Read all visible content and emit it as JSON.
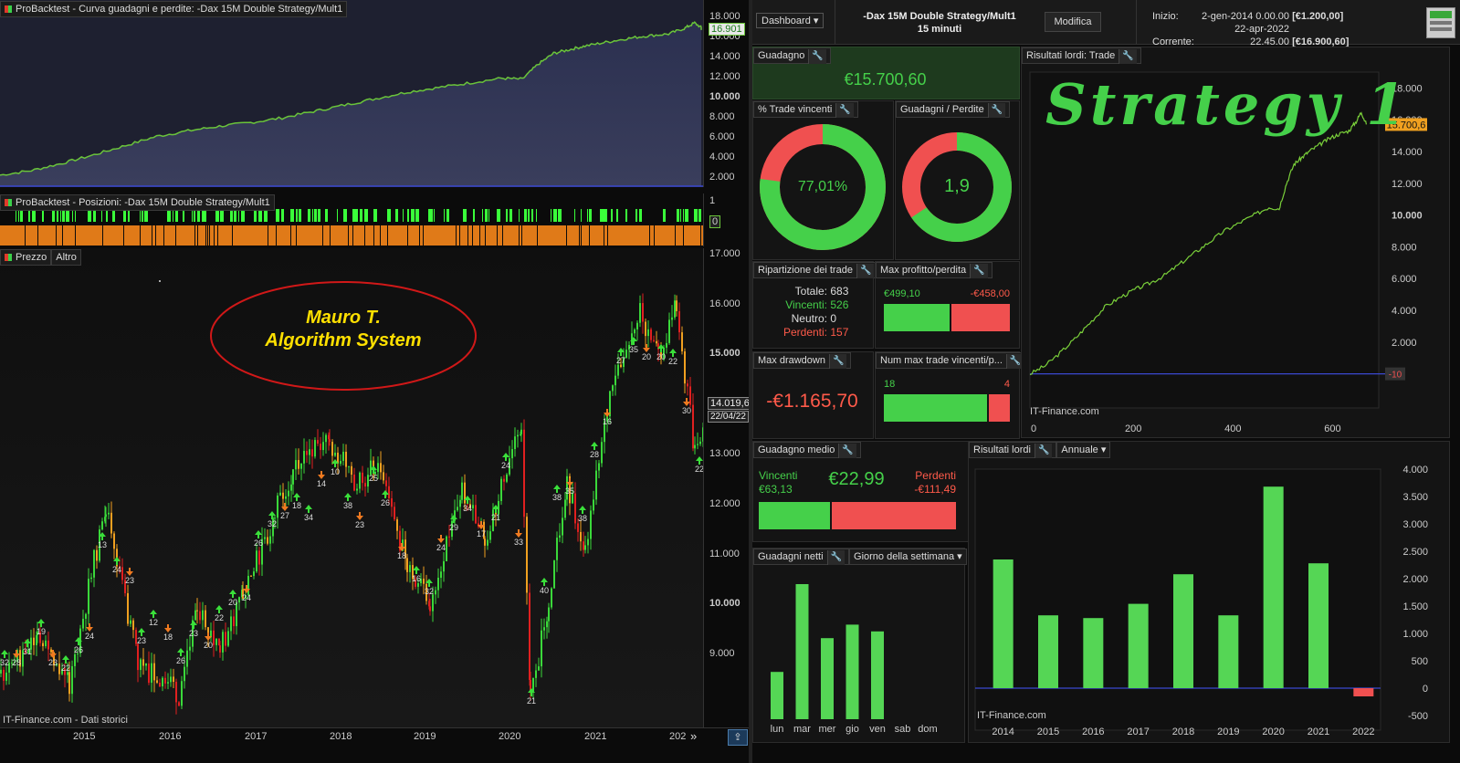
{
  "left": {
    "equity_title": "ProBacktest - Curva guadagni e perdite: -Dax 15M Double Strategy/Mult1",
    "equity_axis": [
      "18.000",
      "16.000",
      "14.000",
      "12.000",
      "10.000",
      "8.000",
      "6.000",
      "4.000",
      "2.000"
    ],
    "equity_current": "16.901",
    "positions_title": "ProBacktest - Posizioni: -Dax 15M Double Strategy/Mult1",
    "positions_axis": [
      "1",
      "0"
    ],
    "price_tabs": [
      "Prezzo",
      "Altro"
    ],
    "price_axis": [
      "17.000",
      "16.000",
      "15.000",
      "14.000",
      "13.000",
      "12.000",
      "11.000",
      "10.000",
      "9.000"
    ],
    "price_current": "14.019,6",
    "price_date": "22/04/22",
    "watermark_line1": "Mauro T.",
    "watermark_line2": "Algorithm System",
    "source_note": "IT-Finance.com - Dati storici",
    "x_axis": [
      "2015",
      "2016",
      "2017",
      "2018",
      "2019",
      "2020",
      "2021",
      "202"
    ],
    "scroll_arrows": "»"
  },
  "header": {
    "dashboard_label": "Dashboard",
    "strategy_name": "-Dax 15M Double Strategy/Mult1",
    "timeframe": "15 minuti",
    "modify_label": "Modifica",
    "start_label": "Inizio:",
    "start_date": "2-gen-2014 0.00.00",
    "start_value": "[€1.200,00]",
    "current_label": "Corrente:",
    "current_date": "22-apr-2022 22.45.00",
    "current_value": "[€16.900,60]"
  },
  "profit": {
    "title": "Guadagno",
    "value": "€15.700,60"
  },
  "win_pct": {
    "title": "% Trade vincenti",
    "value": "77,01%",
    "fraction": 0.7701
  },
  "profit_loss": {
    "title": "Guadagni / Perdite",
    "value": "1,9",
    "fraction": 0.655
  },
  "breakdown": {
    "title": "Ripartizione dei trade",
    "rows": [
      {
        "label": "Totale:",
        "value": "683",
        "color": "#dddddd"
      },
      {
        "label": "Vincenti:",
        "value": "526",
        "color": "#45d04a"
      },
      {
        "label": "Neutro:",
        "value": "0",
        "color": "#dddddd"
      },
      {
        "label": "Perdenti:",
        "value": "157",
        "color": "#ff5a4a"
      }
    ]
  },
  "maxpl": {
    "title": "Max profitto/perdita",
    "max_profit": "€499,10",
    "max_loss": "-€458,00",
    "profit_fraction": 0.52
  },
  "drawdown": {
    "title": "Max drawdown",
    "value": "-€1.165,70"
  },
  "streak": {
    "title": "Num max trade vincenti/p...",
    "wins": "18",
    "losses": "4",
    "win_fraction": 0.82
  },
  "avg": {
    "title": "Guadagno medio",
    "win_label": "Vincenti",
    "win_value": "€63,13",
    "avg_value": "€22,99",
    "loss_label": "Perdenti",
    "loss_value": "-€111,49",
    "win_fraction": 0.36
  },
  "weekday": {
    "title": "Guadagni netti",
    "dropdown": "Giorno della settimana",
    "chart_data": {
      "type": "bar",
      "categories": [
        "lun",
        "mar",
        "mer",
        "gio",
        "ven",
        "sab",
        "dom"
      ],
      "values": [
        0.35,
        1.0,
        0.6,
        0.7,
        0.65,
        0,
        0
      ]
    }
  },
  "trades_chart": {
    "title": "Risultati lordi: Trade",
    "watermark": "Strategy 1",
    "current_value": "15.700,6",
    "min_value": "-10",
    "source_note": "IT-Finance.com",
    "chart_data": {
      "type": "line",
      "x_ticks": [
        "0",
        "200",
        "400",
        "600"
      ],
      "y_ticks": [
        "18.000",
        "16.000",
        "14.000",
        "12.000",
        "10.000",
        "8.000",
        "6.000",
        "4.000",
        "2.000"
      ],
      "xlim": [
        0,
        700
      ],
      "ylim": [
        -1000,
        19000
      ],
      "x": [
        0,
        30,
        60,
        90,
        120,
        150,
        180,
        210,
        240,
        270,
        300,
        330,
        360,
        390,
        420,
        450,
        480,
        500,
        515,
        530,
        545,
        560,
        580,
        600,
        620,
        640,
        655,
        665,
        675
      ],
      "y": [
        -10,
        500,
        1300,
        2200,
        3200,
        4200,
        4800,
        5300,
        5700,
        6200,
        6900,
        7600,
        8300,
        9000,
        9500,
        10000,
        10500,
        10400,
        12000,
        13200,
        13600,
        14000,
        14400,
        14800,
        15100,
        15300,
        15900,
        16500,
        15700
      ]
    }
  },
  "annual": {
    "title": "Risultati lordi",
    "dropdown": "Annuale",
    "source_note": "IT-Finance.com",
    "chart_data": {
      "type": "bar",
      "categories": [
        "2014",
        "2015",
        "2016",
        "2017",
        "2018",
        "2019",
        "2020",
        "2021",
        "2022"
      ],
      "values": [
        2350,
        1330,
        1280,
        1540,
        2080,
        1330,
        3680,
        2280,
        -150
      ],
      "y_ticks": [
        "4.000",
        "3.500",
        "3.000",
        "2.500",
        "2.000",
        "1.500",
        "1.000",
        "500",
        "0",
        "-500"
      ],
      "ylim": [
        -500,
        4000
      ]
    }
  }
}
